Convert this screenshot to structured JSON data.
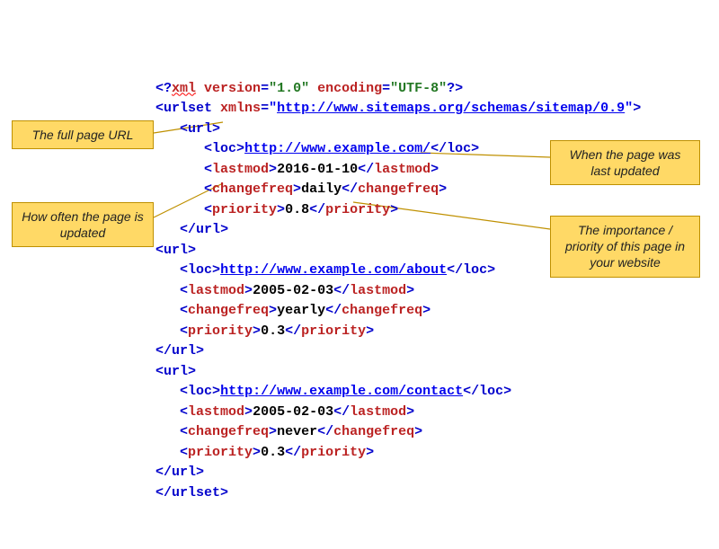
{
  "code": {
    "xmlDeclOpen": "<?",
    "xml": "xml",
    "versionAttr": "version",
    "versionVal": "\"1.0\"",
    "encodingAttr": "encoding",
    "encodingVal": "\"UTF-8\"",
    "xmlDeclClose": "?>",
    "urlsetOpen": "<",
    "urlset": "urlset",
    "xmlnsAttr": "xmlns",
    "eq": "=",
    "quote": "\"",
    "xmlnsVal": "http://www.sitemaps.org/schemas/sitemap/0.9",
    "gt": ">",
    "lt": "<",
    "slash": "/",
    "urlTag": "url",
    "locTag": "loc",
    "lastmodTag": "lastmod",
    "changefreqTag": "changefreq",
    "priorityTag": "priority",
    "urlsetClose": "</urlset>",
    "urls": [
      {
        "loc": "http://www.example.com/",
        "lastmod": "2016-01-10",
        "changefreq": "daily",
        "priority": "0.8"
      },
      {
        "loc": "http://www.example.com/about",
        "lastmod": "2005-02-03",
        "changefreq": "yearly",
        "priority": "0.3"
      },
      {
        "loc": "http://www.example.com/contact",
        "lastmod": "2005-02-03",
        "changefreq": "never",
        "priority": "0.3"
      }
    ]
  },
  "callouts": {
    "c1": "The full page URL",
    "c2": "How often the page is updated",
    "c3": "When the page was last updated",
    "c4": "The importance / priority of this page in your website"
  }
}
